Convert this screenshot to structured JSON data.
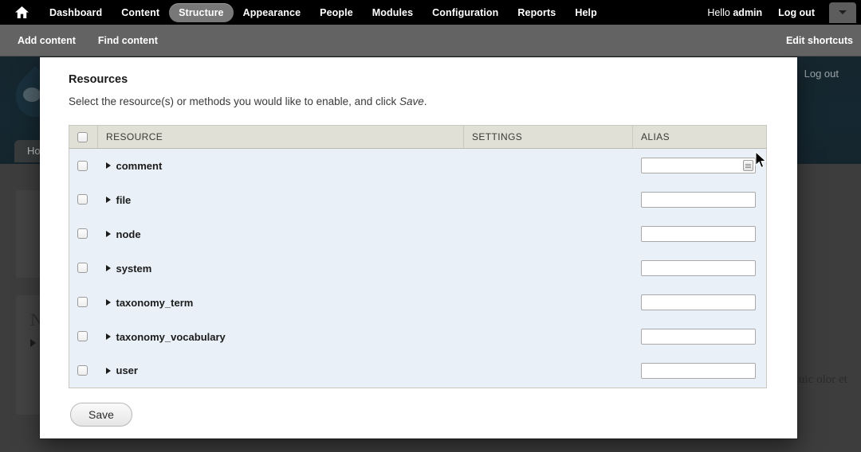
{
  "toolbar": {
    "home_icon": "home-icon",
    "items": [
      {
        "label": "Dashboard",
        "active": false
      },
      {
        "label": "Content",
        "active": false
      },
      {
        "label": "Structure",
        "active": true
      },
      {
        "label": "Appearance",
        "active": false
      },
      {
        "label": "People",
        "active": false
      },
      {
        "label": "Modules",
        "active": false
      },
      {
        "label": "Configuration",
        "active": false
      },
      {
        "label": "Reports",
        "active": false
      },
      {
        "label": "Help",
        "active": false
      }
    ],
    "greeting_prefix": "Hello ",
    "username": "admin",
    "logout_label": "Log out",
    "drawer_toggle_icon": "chevron-down-icon"
  },
  "shortcutbar": {
    "items": [
      {
        "label": "Add content"
      },
      {
        "label": "Find content"
      }
    ],
    "edit_label": "Edit shortcuts"
  },
  "background": {
    "logout_label": "Log out",
    "tab_label": "Ho",
    "letter": "N",
    "text_fragments": "uic\nolor et"
  },
  "modal": {
    "title": "Resources",
    "description_before": "Select the resource(s) or methods you would like to enable, and click ",
    "description_italic": "Save",
    "description_after": ".",
    "table": {
      "headers": [
        "RESOURCE",
        "SETTINGS",
        "ALIAS"
      ],
      "select_all_icon": "checkbox-icon",
      "rows": [
        {
          "name": "comment",
          "settings": "",
          "alias": "",
          "alias_placeholder": "",
          "focused": true
        },
        {
          "name": "file",
          "settings": "",
          "alias": "",
          "alias_placeholder": "",
          "focused": false
        },
        {
          "name": "node",
          "settings": "",
          "alias": "",
          "alias_placeholder": "",
          "focused": false
        },
        {
          "name": "system",
          "settings": "",
          "alias": "",
          "alias_placeholder": "",
          "focused": false
        },
        {
          "name": "taxonomy_term",
          "settings": "",
          "alias": "",
          "alias_placeholder": "",
          "focused": false
        },
        {
          "name": "taxonomy_vocabulary",
          "settings": "",
          "alias": "",
          "alias_placeholder": "",
          "focused": false
        },
        {
          "name": "user",
          "settings": "",
          "alias": "",
          "alias_placeholder": "",
          "focused": false
        }
      ]
    },
    "save_label": "Save"
  },
  "colors": {
    "toolbar_bg": "#000000",
    "shortcut_bg": "#636363",
    "active_pill": "#787878",
    "table_header": "#e0e0d6",
    "table_row": "#e9f0f7",
    "page_dim": "#3d3d3d",
    "drupal_header": "#15262f"
  }
}
